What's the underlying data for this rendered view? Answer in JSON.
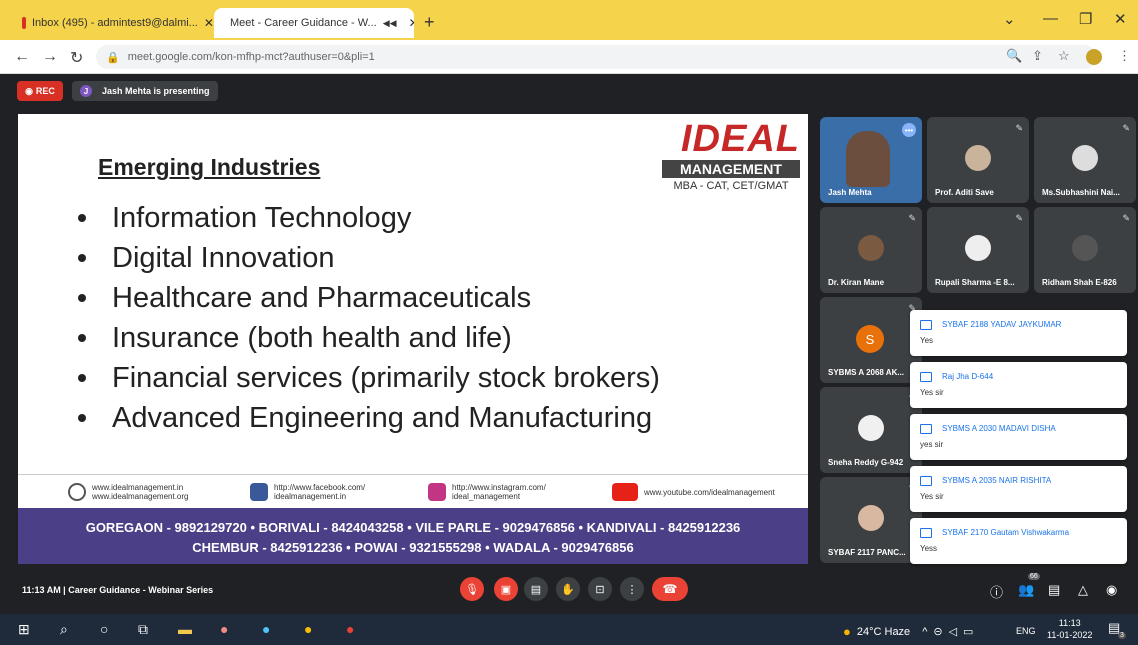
{
  "browser": {
    "tabs": [
      {
        "title": "Inbox (495) - admintest9@dalmi...",
        "icon": "gmail-icon"
      },
      {
        "title": "Meet - Career Guidance - W...",
        "icon": "meet-icon"
      }
    ],
    "new_tab": "+",
    "url": "meet.google.com/kon-mfhp-mct?authuser=0&pli=1"
  },
  "meet": {
    "rec_label": "REC",
    "presenter_initial": "J",
    "presenting_text": "Jash Mehta is presenting",
    "slide": {
      "title": "Emerging Industries",
      "bullets": [
        "Information Technology",
        "Digital Innovation",
        "Healthcare and Pharmaceuticals",
        "Insurance (both health and life)",
        "Financial services (primarily stock brokers)",
        "Advanced Engineering and Manufacturing"
      ],
      "logo_brand": "IDEAL",
      "logo_management": "MANAGEMENT",
      "logo_tagline": "MBA - CAT, CET/GMAT",
      "footer_links": [
        "www.idealmanagement.in\nwww.idealmanagement.org",
        "http://www.facebook.com/\nidealmanagement.in",
        "http://www.instagram.com/\nideal_management",
        "www.youtube.com/idealmanagement"
      ],
      "contact_line1": "GOREGAON - 9892129720 • BORIVALI - 8424043258 • VILE PARLE - 9029476856 • KANDIVALI - 8425912236",
      "contact_line2": "CHEMBUR - 8425912236 • POWAI - 9321555298 • WADALA - 9029476856"
    },
    "participants": [
      "Jash Mehta",
      "Prof. Aditi Save",
      "Ms.Subhashini Nai...",
      "Dr. Kiran Mane",
      "Rupali Sharma -E 8...",
      "Ridham Shah E-826",
      "SYBMS A 2068 AK...",
      "Sneha Reddy G-942",
      "SYBAF 2117 PANC..."
    ],
    "s_avatar": "S",
    "chat": [
      {
        "sender": "SYBAF 2188 YADAV JAYKUMAR",
        "message": "Yes"
      },
      {
        "sender": "Raj Jha D-644",
        "message": "Yes sir"
      },
      {
        "sender": "SYBMS A 2030 MADAVI DISHA",
        "message": "yes sir"
      },
      {
        "sender": "SYBMS A 2035 NAIR RISHITA",
        "message": "Yes sir"
      },
      {
        "sender": "SYBAF 2170 Gautam Vishwakarma",
        "message": "Yess"
      }
    ],
    "meeting_info": "11:13 AM  |  Career Guidance - Webinar Series",
    "people_count": "66"
  },
  "taskbar": {
    "weather": "24°C  Haze",
    "lang": "ENG",
    "time": "11:13",
    "date": "11-01-2022",
    "notif_count": "3"
  }
}
